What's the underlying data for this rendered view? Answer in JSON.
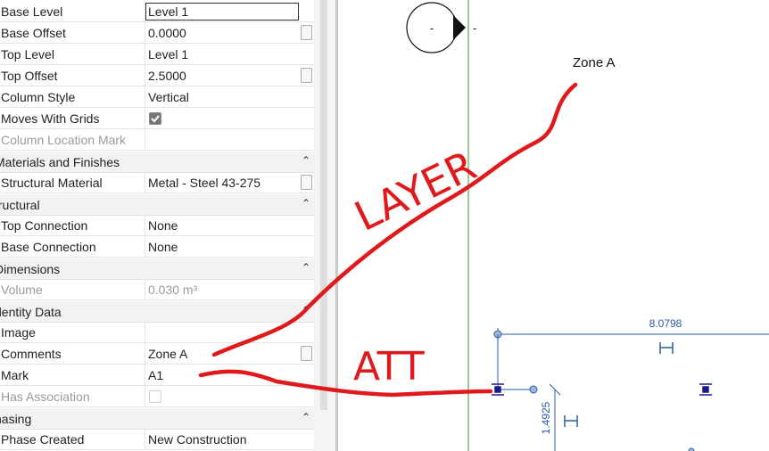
{
  "properties": {
    "rows": [
      {
        "kind": "field",
        "name": "Base Level",
        "value": "Level 1",
        "editing": true
      },
      {
        "kind": "field",
        "name": "Base Offset",
        "value": "0.0000",
        "button": true
      },
      {
        "kind": "field",
        "name": "Top Level",
        "value": "Level 1"
      },
      {
        "kind": "field",
        "name": "Top Offset",
        "value": "2.5000",
        "button": true
      },
      {
        "kind": "field",
        "name": "Column Style",
        "value": "Vertical"
      },
      {
        "kind": "check",
        "name": "Moves With Grids",
        "checked": true
      },
      {
        "kind": "field",
        "name": "Column Location Mark",
        "value": "",
        "dim": true
      },
      {
        "kind": "group",
        "name": "Materials and Finishes"
      },
      {
        "kind": "field",
        "name": "Structural Material",
        "value": "Metal - Steel 43-275",
        "button": true
      },
      {
        "kind": "group",
        "name": "tructural"
      },
      {
        "kind": "field",
        "name": "Top Connection",
        "value": "None"
      },
      {
        "kind": "field",
        "name": "Base Connection",
        "value": "None"
      },
      {
        "kind": "group",
        "name": "Dimensions"
      },
      {
        "kind": "field",
        "name": "Volume",
        "value": "0.030 m³",
        "dim": true
      },
      {
        "kind": "group",
        "name": "dentity Data"
      },
      {
        "kind": "field",
        "name": "Image",
        "value": ""
      },
      {
        "kind": "field",
        "name": "Comments",
        "value": "Zone A",
        "button": true
      },
      {
        "kind": "field",
        "name": "Mark",
        "value": "A1"
      },
      {
        "kind": "check",
        "name": "Has Association",
        "checked": false,
        "dim": true
      },
      {
        "kind": "group",
        "name": "hasing"
      },
      {
        "kind": "field",
        "name": "Phase Created",
        "value": "New Construction"
      }
    ]
  },
  "canvas": {
    "grid_head_label": "-",
    "grid_head_side_label": "-",
    "zone_label": "Zone A",
    "dim_horizontal": "8.0798",
    "dim_vertical": "1.4925"
  },
  "annotations": {
    "word1": "LAYER",
    "word2": "ATT",
    "ink_color": "#e0191c"
  },
  "colors": {
    "grid_line": "#2e9a2e",
    "dimension": "#2a5aa8",
    "column_marker": "#1a1a8a"
  }
}
